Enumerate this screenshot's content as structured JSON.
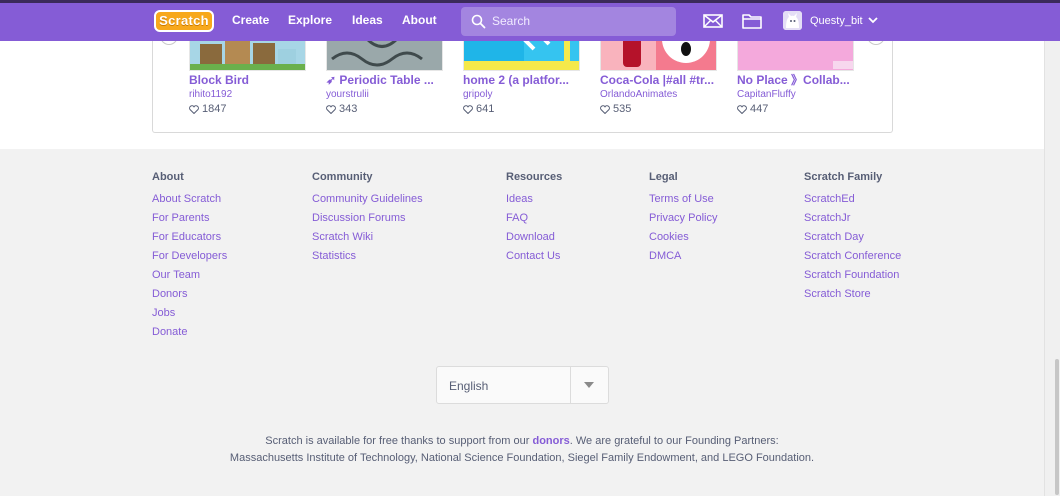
{
  "nav": {
    "logo": "Scratch",
    "links": [
      "Create",
      "Explore",
      "Ideas",
      "About"
    ],
    "search_placeholder": "Search",
    "username": "Questy_bit"
  },
  "projects": [
    {
      "title": "Block Bird",
      "author": "rihito1192",
      "loves": "1847"
    },
    {
      "title": "➶ Periodic Table ...",
      "author": "yourstrulii",
      "loves": "343"
    },
    {
      "title": "home 2 (a platfor...",
      "author": "gripoly",
      "loves": "641"
    },
    {
      "title": "Coca-Cola |#all #tr...",
      "author": "OrlandoAnimates",
      "loves": "535"
    },
    {
      "title": "No Place 》Collab...",
      "author": "CapitanFluffy",
      "loves": "447"
    }
  ],
  "footer": {
    "columns": [
      {
        "title": "About",
        "links": [
          "About Scratch",
          "For Parents",
          "For Educators",
          "For Developers",
          "Our Team",
          "Donors",
          "Jobs",
          "Donate"
        ]
      },
      {
        "title": "Community",
        "links": [
          "Community Guidelines",
          "Discussion Forums",
          "Scratch Wiki",
          "Statistics"
        ]
      },
      {
        "title": "Resources",
        "links": [
          "Ideas",
          "FAQ",
          "Download",
          "Contact Us"
        ]
      },
      {
        "title": "Legal",
        "links": [
          "Terms of Use",
          "Privacy Policy",
          "Cookies",
          "DMCA"
        ]
      },
      {
        "title": "Scratch Family",
        "links": [
          "ScratchEd",
          "ScratchJr",
          "Scratch Day",
          "Scratch Conference",
          "Scratch Foundation",
          "Scratch Store"
        ]
      }
    ],
    "language": "English",
    "credits_line1_before": "Scratch is available for free thanks to support from our ",
    "credits_donors": "donors",
    "credits_line1_after": ". We are grateful to our Founding Partners:",
    "credits_line2": "Massachusetts Institute of Technology, National Science Foundation, Siegel Family Endowment, and LEGO Foundation."
  },
  "colors": {
    "brand": "#855cd6",
    "logo": "#f7a81b",
    "text": "#575e75",
    "background": "#f2f2f2"
  }
}
